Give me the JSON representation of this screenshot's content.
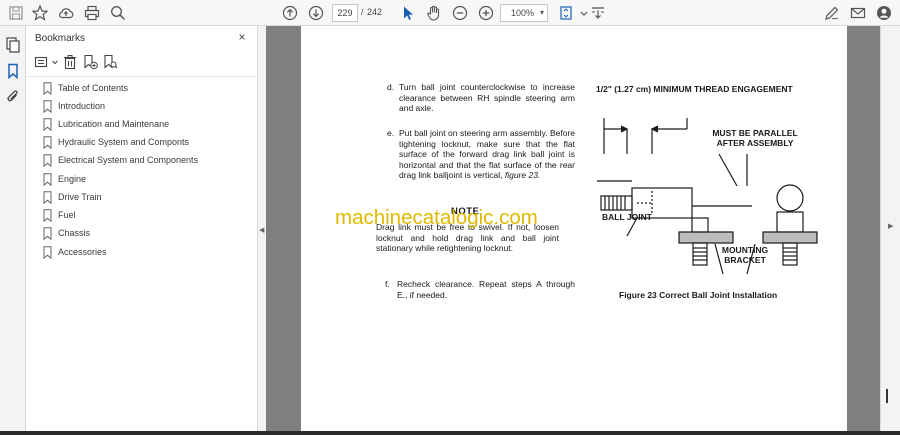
{
  "toolbar": {
    "page_current": "229",
    "page_separator": "/",
    "page_total": "242",
    "zoom": "100%"
  },
  "bookmarks": {
    "title": "Bookmarks",
    "close": "×",
    "items": [
      {
        "label": "Table of Contents"
      },
      {
        "label": "Introduction"
      },
      {
        "label": "Lubrication and Maintenane"
      },
      {
        "label": "Hydraulic System and Componts"
      },
      {
        "label": "Electrical System and Components"
      },
      {
        "label": "Engine"
      },
      {
        "label": "Drive Train"
      },
      {
        "label": "Fuel"
      },
      {
        "label": "Chassis"
      },
      {
        "label": "Accessories"
      }
    ]
  },
  "document": {
    "step_d_lead": "d.",
    "step_d": "Turn ball joint counterclockwise to increase clearance between RH spindle steering arm and axle.",
    "step_e_lead": "e.",
    "step_e": "Put ball joint on steering arm assembly. Before tightening locknut, make sure that the flat surface of the forward drag link ball joint is horizontal and that the flat surface of the rear drag link balljoint is vertical,",
    "step_e_ref": "figure 23.",
    "note_heading": "NOTE",
    "note_text": "Drag link must be free to swivel. If not, loosen locknut and hold drag link and ball joint stationary while retightening locknut.",
    "step_f_lead": "f.",
    "step_f": "Recheck clearance. Repeat steps A through E., if needed.",
    "watermark": "machinecatalogic.com",
    "figure": {
      "thread_label": "1/2\" (1.27 cm) MINIMUM THREAD ENGAGEMENT",
      "parallel_label_1": "MUST BE PARALLEL",
      "parallel_label_2": "AFTER ASSEMBLY",
      "ball_joint_label": "BALL JOINT",
      "bracket_label_1": "MOUNTING",
      "bracket_label_2": "BRACKET",
      "caption": "Figure 23 Correct Ball Joint Installation"
    }
  },
  "colors": {
    "watermark": "#e1b800",
    "doc_background": "#7f7f7f"
  }
}
